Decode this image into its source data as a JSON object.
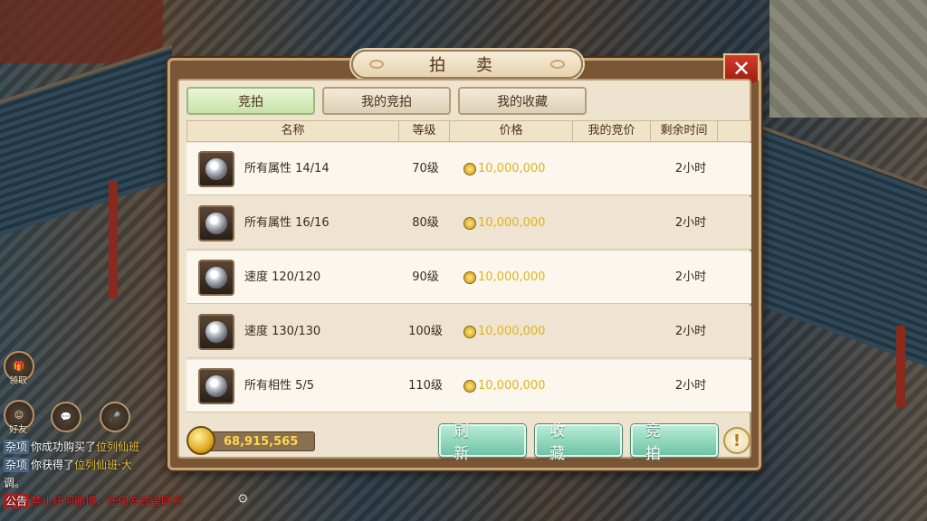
{
  "window": {
    "title": "拍 卖"
  },
  "tabs": [
    {
      "label": "竞拍",
      "active": true
    },
    {
      "label": "我的竞拍",
      "active": false
    },
    {
      "label": "我的收藏",
      "active": false
    }
  ],
  "table": {
    "headers": [
      "名称",
      "等级",
      "价格",
      "我的竞价",
      "剩余时间"
    ],
    "rows": [
      {
        "name": "所有属性 14/14",
        "level": "70级",
        "price": "10,000,000",
        "my_bid": "",
        "time_left": "2小时"
      },
      {
        "name": "所有属性 16/16",
        "level": "80级",
        "price": "10,000,000",
        "my_bid": "",
        "time_left": "2小时"
      },
      {
        "name": "速度 120/120",
        "level": "90级",
        "price": "10,000,000",
        "my_bid": "",
        "time_left": "2小时"
      },
      {
        "name": "速度 130/130",
        "level": "100级",
        "price": "10,000,000",
        "my_bid": "",
        "time_left": "2小时"
      },
      {
        "name": "所有相性 5/5",
        "level": "110级",
        "price": "10,000,000",
        "my_bid": "",
        "time_left": "2小时"
      }
    ]
  },
  "footer": {
    "money": "68,915,565",
    "refresh_label": "刷 新",
    "favorite_label": "收 藏",
    "bid_label": "竞 拍",
    "info_symbol": "!"
  },
  "side": {
    "claim_label": "领取",
    "friend_label": "好友"
  },
  "chat": [
    {
      "tag": "杂项",
      "text": "你成功购买了",
      "link": "位列仙班"
    },
    {
      "tag": "杂项",
      "text": "你获得了",
      "link": "位列仙班·大"
    },
    {
      "tag": "",
      "text": "调。",
      "link": ""
    },
    {
      "tag": "公告",
      "text": "",
      "link": "禁止任何赌博，任何方式留联系"
    }
  ],
  "colors": {
    "price": "#e0b41a",
    "accent_button": "#6ec4a6",
    "close": "#d23a2a"
  }
}
